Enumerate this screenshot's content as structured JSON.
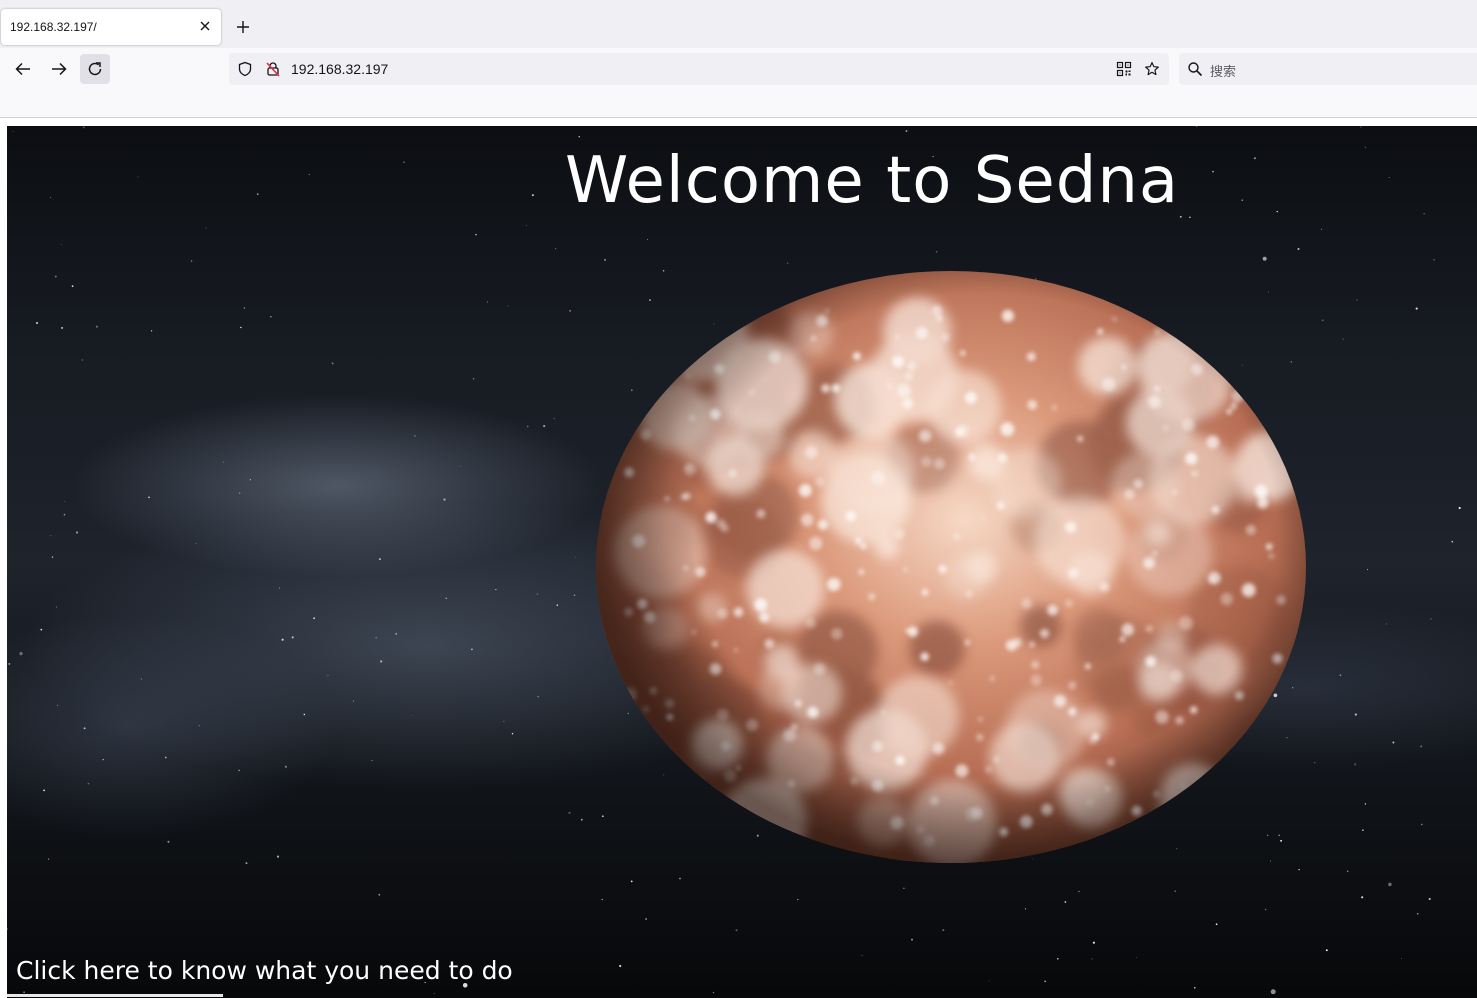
{
  "browser": {
    "tab": {
      "title": "192.168.32.197/"
    },
    "address": {
      "url": "192.168.32.197"
    },
    "search": {
      "placeholder": "搜索"
    }
  },
  "page": {
    "heading": "Welcome to Sedna",
    "link_text": "Click here to know what you need to do"
  },
  "colors": {
    "planet_base": "#c07a60",
    "planet_light": "#fbe9dc",
    "space": "#111419"
  },
  "icons": [
    "close-icon",
    "plus-icon",
    "back-arrow-icon",
    "forward-arrow-icon",
    "reload-icon",
    "shield-icon",
    "insecure-lock-icon",
    "qr-code-icon",
    "star-icon",
    "search-icon"
  ]
}
